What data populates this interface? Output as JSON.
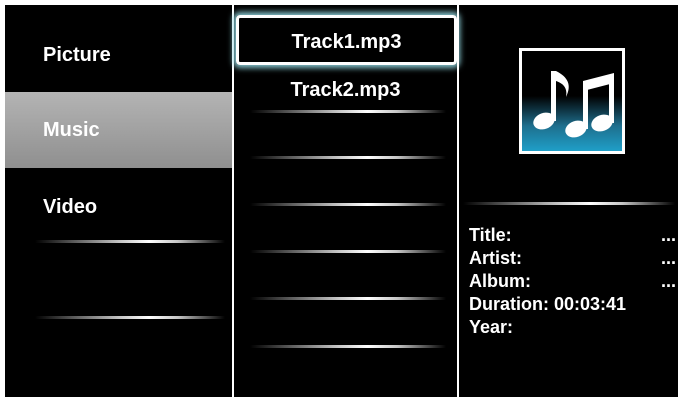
{
  "menu": {
    "items": [
      {
        "label": "Picture"
      },
      {
        "label": "Music"
      },
      {
        "label": "Video"
      }
    ],
    "selected": "Music"
  },
  "tracks": [
    {
      "label": "Track1.mp3"
    },
    {
      "label": "Track2.mp3"
    }
  ],
  "details": {
    "art_icon": "music-notes-icon",
    "title_label": "Title:",
    "title_value": "...",
    "artist_label": "Artist:",
    "artist_value": "...",
    "album_label": "Album:",
    "album_value": "...",
    "duration_label": "Duration:",
    "duration_value": "00:03:41",
    "year_label": "Year:"
  },
  "colors": {
    "background": "#000000",
    "selected_item": "#a0a0a0",
    "focus_glow": "#96dce6",
    "art_blue": "#1f9fc8"
  }
}
